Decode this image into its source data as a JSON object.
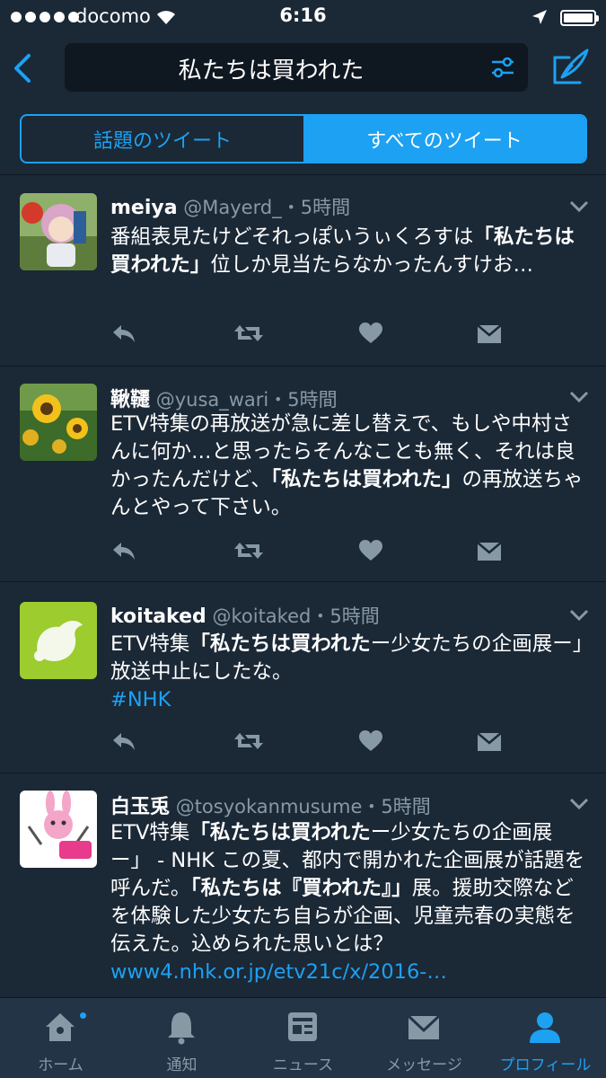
{
  "status_bar": {
    "carrier": "docomo",
    "time": "6:16"
  },
  "search": {
    "query": "私たちは買われた"
  },
  "segments": {
    "top": "話題のツイート",
    "all": "すべてのツイート"
  },
  "tweets": [
    {
      "name": "meiya",
      "handle": "@Mayerd_",
      "time": "・5時間",
      "text": [
        {
          "t": "番組表見たけどそれっぽいうぃくろすは"
        },
        {
          "t": "「私たちは買われた」",
          "hl": true
        },
        {
          "t": "位しか見当たらなかったんすけお…"
        }
      ]
    },
    {
      "name": "鞦韆",
      "handle": "@yusa_wari",
      "time": "・5時間",
      "text": [
        {
          "t": "ETV特集の再放送が急に差し替えで、もしや中村さんに何か…と思ったらそんなことも無く、それは良かったんだけど、"
        },
        {
          "t": "「私たちは買われた」",
          "hl": true
        },
        {
          "t": "の再放送ちゃんとやって下さい。"
        }
      ]
    },
    {
      "name": "koitaked",
      "handle": "@koitaked",
      "time": "・5時間",
      "text": [
        {
          "t": "ETV特集"
        },
        {
          "t": "「私たちは買われた",
          "hl": true
        },
        {
          "t": "ー少女たちの企画展ー」放送中止にしたな。"
        },
        {
          "t": "#NHK",
          "link": true
        }
      ]
    },
    {
      "name": "白玉兎",
      "handle": "@tosyokanmusume",
      "time": "・5時間",
      "text": [
        {
          "t": "ETV特集"
        },
        {
          "t": "「私たちは買われた",
          "hl": true
        },
        {
          "t": "ー少女たちの企画展ー」 - NHK この夏、都内で開かれた企画展が話題を呼んだ。"
        },
        {
          "t": "「私たちは『買われた』」",
          "hl": true
        },
        {
          "t": "展。援助交際などを体験した少女たち自らが企画、児童売春の実態を伝えた。込められた思いとは？ "
        },
        {
          "t": "www4.nhk.or.jp/etv21c/x/2016-…",
          "link": true
        }
      ]
    }
  ],
  "tabs": [
    "ホーム",
    "通知",
    "ニュース",
    "メッセージ",
    "プロフィール"
  ],
  "colors": {
    "accent": "#1da1f2",
    "background": "#1b2836",
    "muted": "#8899a6"
  }
}
